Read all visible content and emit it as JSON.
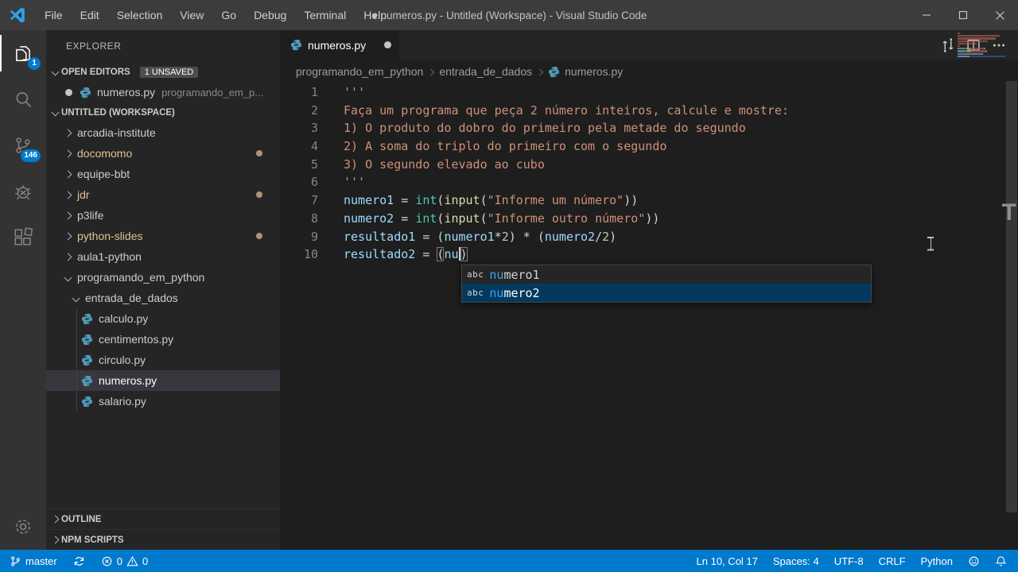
{
  "titlebar": {
    "menus": [
      "File",
      "Edit",
      "Selection",
      "View",
      "Go",
      "Debug",
      "Terminal",
      "Help"
    ],
    "title": "● numeros.py - Untitled (Workspace) - Visual Studio Code"
  },
  "activity_bar": {
    "items": [
      {
        "icon": "files",
        "name": "explorer",
        "badge": "1",
        "active": true
      },
      {
        "icon": "search",
        "name": "search"
      },
      {
        "icon": "source-control",
        "name": "source-control",
        "badge": "146"
      },
      {
        "icon": "debug",
        "name": "debug"
      },
      {
        "icon": "extensions",
        "name": "extensions"
      }
    ],
    "bottom_items": [
      {
        "icon": "gear",
        "name": "manage"
      }
    ]
  },
  "sidebar": {
    "title": "EXPLORER",
    "open_editors": {
      "label": "OPEN EDITORS",
      "badge": "1 UNSAVED",
      "items": [
        {
          "name": "numeros.py",
          "description": "programando_em_p...",
          "dirty": true
        }
      ]
    },
    "workspace_label": "UNTITLED (WORKSPACE)",
    "tree": [
      {
        "label": "arcadia-institute",
        "type": "folder",
        "level": 0,
        "expanded": false
      },
      {
        "label": "docomomo",
        "type": "folder",
        "level": 0,
        "expanded": false,
        "modified": true
      },
      {
        "label": "equipe-bbt",
        "type": "folder",
        "level": 0,
        "expanded": false
      },
      {
        "label": "jdr",
        "type": "folder",
        "level": 0,
        "expanded": false,
        "modified": true
      },
      {
        "label": "p3life",
        "type": "folder",
        "level": 0,
        "expanded": false
      },
      {
        "label": "python-slides",
        "type": "folder",
        "level": 0,
        "expanded": false,
        "modified": true
      },
      {
        "label": "aula1-python",
        "type": "folder",
        "level": 0,
        "expanded": false
      },
      {
        "label": "programando_em_python",
        "type": "folder",
        "level": 0,
        "expanded": true
      },
      {
        "label": "entrada_de_dados",
        "type": "folder",
        "level": 1,
        "expanded": true
      },
      {
        "label": "calculo.py",
        "type": "file",
        "level": 2
      },
      {
        "label": "centimentos.py",
        "type": "file",
        "level": 2
      },
      {
        "label": "circulo.py",
        "type": "file",
        "level": 2
      },
      {
        "label": "numeros.py",
        "type": "file",
        "level": 2,
        "selected": true
      },
      {
        "label": "salario.py",
        "type": "file",
        "level": 2
      }
    ],
    "bottom_sections": [
      {
        "label": "OUTLINE"
      },
      {
        "label": "NPM SCRIPTS"
      }
    ]
  },
  "editor": {
    "tab": {
      "label": "numeros.py",
      "dirty": true
    },
    "breadcrumbs": [
      "programando_em_python",
      "entrada_de_dados",
      "numeros.py"
    ],
    "code_lines": [
      {
        "num": "1",
        "tokens": [
          [
            "str",
            "'''"
          ]
        ]
      },
      {
        "num": "2",
        "tokens": [
          [
            "str",
            "Faça um programa que peça 2 número inteiros, calcule e mostre:"
          ]
        ]
      },
      {
        "num": "3",
        "tokens": [
          [
            "str",
            "1) O produto do dobro do primeiro pela metade do segundo"
          ]
        ]
      },
      {
        "num": "4",
        "tokens": [
          [
            "str",
            "2) A soma do triplo do primeiro com o segundo"
          ]
        ]
      },
      {
        "num": "5",
        "tokens": [
          [
            "str",
            "3) O segundo elevado ao cubo"
          ]
        ]
      },
      {
        "num": "6",
        "tokens": [
          [
            "str",
            "'''"
          ]
        ]
      },
      {
        "num": "7",
        "tokens": [
          [
            "var",
            "numero1"
          ],
          [
            "plain",
            " = "
          ],
          [
            "type",
            "int"
          ],
          [
            "plain",
            "("
          ],
          [
            "func",
            "input"
          ],
          [
            "plain",
            "("
          ],
          [
            "str",
            "\"Informe um número\""
          ],
          [
            "plain",
            "))"
          ]
        ]
      },
      {
        "num": "8",
        "tokens": [
          [
            "var",
            "numero2"
          ],
          [
            "plain",
            " = "
          ],
          [
            "type",
            "int"
          ],
          [
            "plain",
            "("
          ],
          [
            "func",
            "input"
          ],
          [
            "plain",
            "("
          ],
          [
            "str",
            "\"Informe outro número\""
          ],
          [
            "plain",
            "))"
          ]
        ]
      },
      {
        "num": "9",
        "tokens": [
          [
            "var",
            "resultado1"
          ],
          [
            "plain",
            " = ("
          ],
          [
            "var",
            "numero1"
          ],
          [
            "plain",
            "*"
          ],
          [
            "num",
            "2"
          ],
          [
            "plain",
            ") * ("
          ],
          [
            "var",
            "numero2"
          ],
          [
            "plain",
            "/"
          ],
          [
            "num",
            "2"
          ],
          [
            "plain",
            ")"
          ]
        ]
      },
      {
        "num": "10",
        "tokens": [
          [
            "var",
            "resultado2"
          ],
          [
            "plain",
            " = "
          ],
          [
            "brkt",
            "("
          ],
          [
            "var",
            "nu"
          ],
          [
            "caret",
            ""
          ],
          [
            "brkt",
            ")"
          ]
        ]
      }
    ],
    "suggest": {
      "items": [
        {
          "kind": "abc",
          "match": "nu",
          "rest": "mero1",
          "selected": false
        },
        {
          "kind": "abc",
          "match": "nu",
          "rest": "mero2",
          "selected": true
        }
      ]
    }
  },
  "status_bar": {
    "left": [
      {
        "icon": "branch",
        "label": "master",
        "name": "git-branch"
      },
      {
        "icon": "sync",
        "label": "",
        "name": "sync"
      },
      {
        "icon": "error",
        "label": "0",
        "icon2": "warning",
        "label2": "0",
        "name": "problems"
      }
    ],
    "right": [
      {
        "label": "Ln 10, Col 17",
        "name": "cursor-position"
      },
      {
        "label": "Spaces: 4",
        "name": "indentation"
      },
      {
        "label": "UTF-8",
        "name": "encoding"
      },
      {
        "label": "CRLF",
        "name": "eol"
      },
      {
        "label": "Python",
        "name": "language-mode"
      },
      {
        "icon": "smiley",
        "label": "",
        "name": "feedback"
      },
      {
        "icon": "bell",
        "label": "",
        "name": "notifications"
      }
    ]
  },
  "colors": {
    "statusbar": "#007acc",
    "badge": "#007acc",
    "git_modified": "#e2c08d",
    "selection_row": "#37373d",
    "suggest_selected": "#04395e",
    "string": "#ce9178",
    "variable": "#9cdcfe",
    "type": "#4ec9b0",
    "function": "#dcdcaa",
    "number": "#b5cea8"
  }
}
